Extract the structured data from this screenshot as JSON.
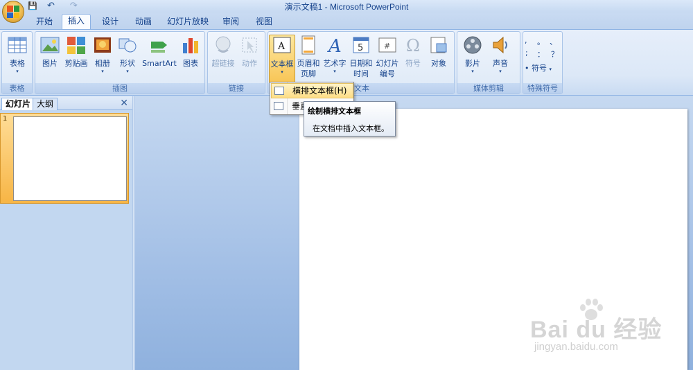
{
  "window": {
    "title": "演示文稿1 - Microsoft PowerPoint",
    "qat_save": "💾",
    "qat_undo": "↶",
    "qat_redo": "↷"
  },
  "tabs": [
    {
      "label": "开始"
    },
    {
      "label": "插入"
    },
    {
      "label": "设计"
    },
    {
      "label": "动画"
    },
    {
      "label": "幻灯片放映"
    },
    {
      "label": "审阅"
    },
    {
      "label": "视图"
    }
  ],
  "ribbon": {
    "groups": {
      "table": "表格",
      "illustrations": "插图",
      "links": "链接",
      "text": "文本",
      "media": "媒体剪辑",
      "special": "特殊符号"
    },
    "buttons": {
      "table": "表格",
      "picture": "图片",
      "clipart": "剪贴画",
      "album": "相册",
      "shapes": "形状",
      "smartart": "SmartArt",
      "chart": "图表",
      "hyperlink": "超链接",
      "action": "动作",
      "textbox": "文本框",
      "header_line1": "页眉和",
      "header_line2": "页脚",
      "wordart": "艺术字",
      "datetime_line1": "日期和",
      "datetime_line2": "时间",
      "slideno_line1": "幻灯片",
      "slideno_line2": "编号",
      "symbol": "符号",
      "object": "对象",
      "movie": "影片",
      "sound": "声音",
      "special_symbol": "符号"
    },
    "special_chars": [
      ",",
      "。",
      "、",
      ";",
      "：",
      "？"
    ]
  },
  "left_panel": {
    "tab_slides": "幻灯片",
    "tab_outline": "大纲",
    "close": "✕",
    "slide_number": "1"
  },
  "dropdown": {
    "item1": "横排文本框(H)",
    "item2": "垂直"
  },
  "tooltip": {
    "title": "绘制横排文本框",
    "description": "在文档中插入文本框。"
  },
  "watermark": {
    "main": "Bai du 经验",
    "sub": "jingyan.baidu.com"
  }
}
